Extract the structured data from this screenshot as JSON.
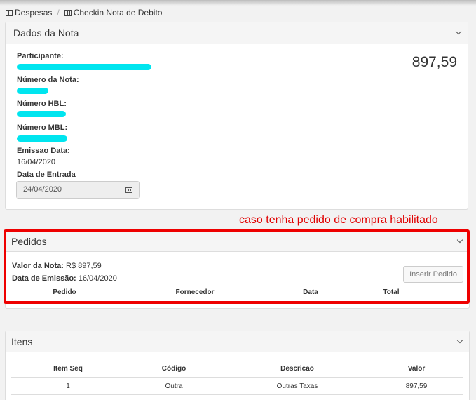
{
  "breadcrumb": {
    "items": [
      {
        "label": "Despesas",
        "icon": "table-icon"
      },
      {
        "label": "Checkin Nota de Debito",
        "icon": "table-icon"
      }
    ],
    "separator": "/"
  },
  "dados": {
    "title": "Dados da Nota",
    "amount": "897,59",
    "participante_label": "Participante:",
    "numero_nota_label": "Número da Nota:",
    "numero_hbl_label": "Número HBL:",
    "numero_mbl_label": "Número MBL:",
    "emissao_label": "Emissao Data:",
    "emissao_value": "16/04/2020",
    "entrada_label": "Data de Entrada",
    "entrada_value": "24/04/2020",
    "redaction_color": "#00e5ef"
  },
  "annotation": {
    "text": "caso tenha pedido de compra habilitado",
    "color": "#e00000"
  },
  "pedidos": {
    "title": "Pedidos",
    "valor_label": "Valor da Nota:",
    "valor_value": "R$ 897,59",
    "emissao_label": "Data de Emissão:",
    "emissao_value": "16/04/2020",
    "insert_button": "Inserir Pedido",
    "columns": [
      "Pedido",
      "Fornecedor",
      "Data",
      "Total"
    ]
  },
  "itens": {
    "title": "Itens",
    "columns": [
      "Item Seq",
      "Código",
      "Descricao",
      "Valor"
    ],
    "rows": [
      [
        "1",
        "Outra",
        "Outras Taxas",
        "897,59"
      ]
    ]
  }
}
